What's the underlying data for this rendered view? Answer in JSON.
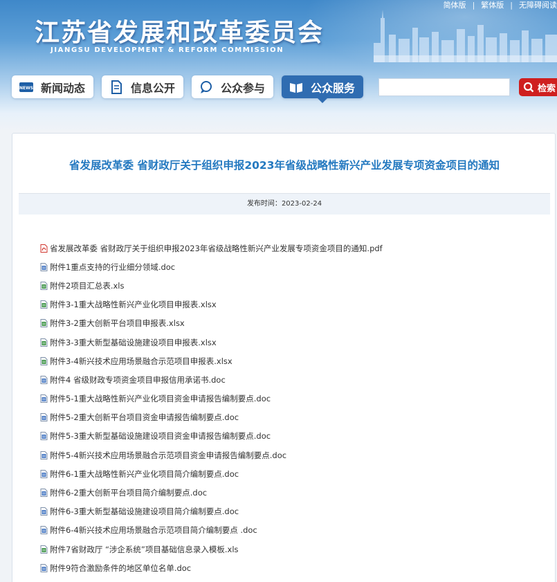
{
  "site": {
    "title": "江苏省发展和改革委员会",
    "subtitle": "JIANGSU DEVELOPMENT & REFORM COMMISSION"
  },
  "top_links": [
    "简体版",
    "繁体版",
    "无障碍阅读"
  ],
  "nav": [
    {
      "label": "新闻动态",
      "icon": "news-icon"
    },
    {
      "label": "信息公开",
      "icon": "document-icon"
    },
    {
      "label": "公众参与",
      "icon": "chat-icon"
    },
    {
      "label": "公众服务",
      "icon": "book-icon",
      "active": true
    }
  ],
  "search": {
    "placeholder": "",
    "button_label": "检索"
  },
  "article": {
    "title": "省发展改革委 省财政厅关于组织申报2023年省级战略性新兴产业发展专项资金项目的通知",
    "publish_label": "发布时间：",
    "publish_date": "2023-02-24"
  },
  "attachments": [
    {
      "name": "省发展改革委  省财政厅关于组织申报2023年省级战略性新兴产业发展专项资金项目的通知.pdf",
      "type": "pdf"
    },
    {
      "name": "附件1重点支持的行业细分领域.doc",
      "type": "doc"
    },
    {
      "name": "附件2项目汇总表.xls",
      "type": "xls"
    },
    {
      "name": "附件3-1重大战略性新兴产业化项目申报表.xlsx",
      "type": "xls"
    },
    {
      "name": "附件3-2重大创新平台项目申报表.xlsx",
      "type": "xls"
    },
    {
      "name": "附件3-3重大新型基础设施建设项目申报表.xlsx",
      "type": "xls"
    },
    {
      "name": "附件3-4新兴技术应用场景融合示范项目申报表.xlsx",
      "type": "xls"
    },
    {
      "name": "附件4 省级财政专项资金项目申报信用承诺书.doc",
      "type": "doc"
    },
    {
      "name": "附件5-1重大战略性新兴产业化项目资金申请报告编制要点.doc",
      "type": "doc"
    },
    {
      "name": "附件5-2重大创新平台项目资金申请报告编制要点.doc",
      "type": "doc"
    },
    {
      "name": "附件5-3重大新型基础设施建设项目资金申请报告编制要点.doc",
      "type": "doc"
    },
    {
      "name": "附件5-4新兴技术应用场景融合示范项目资金申请报告编制要点.doc",
      "type": "doc"
    },
    {
      "name": "附件6-1重大战略性新兴产业化项目简介编制要点.doc",
      "type": "doc"
    },
    {
      "name": "附件6-2重大创新平台项目简介编制要点.doc",
      "type": "doc"
    },
    {
      "name": "附件6-3重大新型基础设施建设项目简介编制要点.doc",
      "type": "doc"
    },
    {
      "name": "附件6-4新兴技术应用场景融合示范项目简介编制要点 .doc",
      "type": "doc"
    },
    {
      "name": "附件7省财政厅 “涉企系统”项目基础信息录入模板.xls",
      "type": "xls"
    },
    {
      "name": "附件9符合激励条件的地区单位名单.doc",
      "type": "doc"
    }
  ],
  "colors": {
    "accent": "#2479c0",
    "nav_active": "#2f6cb1",
    "search_button": "#cf1f1f",
    "pdf_icon": "#d0342c",
    "doc_icon": "#3a6fbf",
    "xls_icon": "#2e8b3a"
  }
}
